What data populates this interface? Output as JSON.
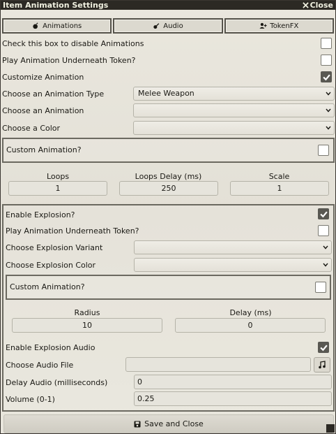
{
  "window": {
    "title": "Item Animation Settings",
    "close_label": "Close"
  },
  "tabs": [
    {
      "label": "Animations",
      "icon": "bomb-icon"
    },
    {
      "label": "Audio",
      "icon": "guitar-icon"
    },
    {
      "label": "TokenFX",
      "icon": "user-plus-icon"
    }
  ],
  "animations": {
    "disable_label": "Check this box to disable Animations",
    "disable_checked": false,
    "underneath_label": "Play Animation Underneath Token?",
    "underneath_checked": false,
    "customize_label": "Customize Animation",
    "customize_checked": true,
    "type_label": "Choose an Animation Type",
    "type_value": "Melee Weapon",
    "anim_label": "Choose an Animation",
    "anim_value": "",
    "color_label": "Choose a Color",
    "color_value": "",
    "custom_label": "Custom Animation?",
    "custom_checked": false
  },
  "loops": {
    "loops_label": "Loops",
    "loops_value": "1",
    "delay_label": "Loops Delay (ms)",
    "delay_value": "250",
    "scale_label": "Scale",
    "scale_value": "1"
  },
  "explosion": {
    "enable_label": "Enable Explosion?",
    "enable_checked": true,
    "underneath_label": "Play Animation Underneath Token?",
    "underneath_checked": false,
    "variant_label": "Choose Explosion Variant",
    "variant_value": "",
    "color_label": "Choose Explosion Color",
    "color_value": "",
    "custom_label": "Custom Animation?",
    "custom_checked": false,
    "radius_label": "Radius",
    "radius_value": "10",
    "delay_label": "Delay (ms)",
    "delay_value": "0",
    "audio_enable_label": "Enable Explosion Audio",
    "audio_enable_checked": true,
    "audio_file_label": "Choose Audio File",
    "audio_file_value": "",
    "audio_delay_label": "Delay Audio (milliseconds)",
    "audio_delay_value": "0",
    "volume_label": "Volume (0-1)",
    "volume_value": "0.25"
  },
  "footer": {
    "save_label": "Save and Close"
  },
  "colors": {
    "titlebar": "#2c2924",
    "checked": "#595852"
  }
}
